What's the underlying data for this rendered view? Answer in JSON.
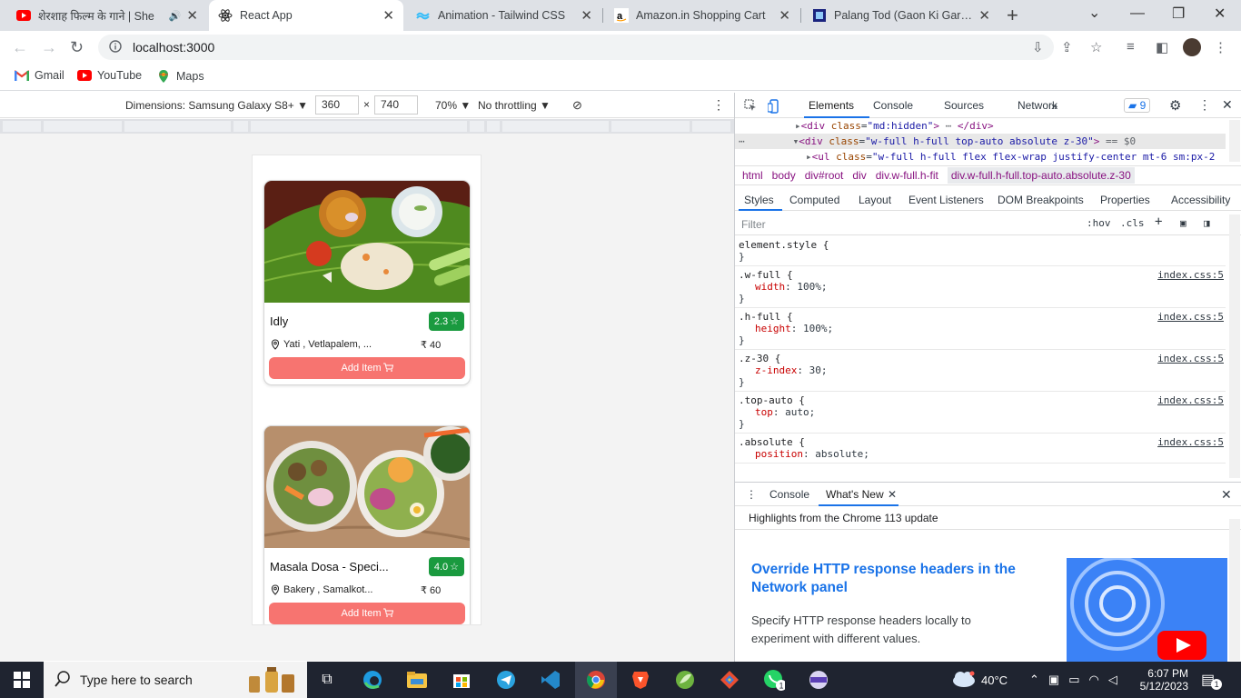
{
  "browser": {
    "tabs": [
      {
        "title": "शेरशाह फिल्म के गाने | She",
        "has_audio": true
      },
      {
        "title": "React App",
        "active": true
      },
      {
        "title": "Animation - Tailwind CSS"
      },
      {
        "title": "Amazon.in Shopping Cart"
      },
      {
        "title": "Palang Tod (Gaon Ki Garmi 3"
      }
    ],
    "url": "localhost:3000",
    "bookmarks": [
      "Gmail",
      "YouTube",
      "Maps"
    ]
  },
  "device_toolbar": {
    "dimensions_label": "Dimensions: Samsung Galaxy S8+",
    "width": "360",
    "times": "×",
    "height": "740",
    "zoom": "70%",
    "throttling": "No throttling"
  },
  "app": {
    "cards": [
      {
        "name": "Idly",
        "rating": "2.3",
        "location": "Yati , Vetlapalem, ...",
        "price": "₹ 40",
        "button": "Add Item"
      },
      {
        "name": "Masala Dosa - Speci...",
        "rating": "4.0",
        "location": "Bakery , Samalkot...",
        "price": "₹ 60",
        "button": "Add Item"
      }
    ]
  },
  "devtools": {
    "tabs": [
      "Elements",
      "Console",
      "Sources",
      "Network"
    ],
    "issues_count": "9",
    "dom_lines": [
      {
        "tag": "div",
        "attr_name": "class",
        "attr_value": "md:hidden",
        "suffix": "</div>"
      },
      {
        "tag": "div",
        "attr_name": "class",
        "attr_value": "w-full h-full top-auto absolute z-30",
        "suffix": "== $0"
      },
      {
        "tag": "ul",
        "attr_name": "class",
        "attr_value": "w-full h-full flex flex-wrap justify-center mt-6  sm:px-2",
        "suffix": ""
      }
    ],
    "breadcrumbs": [
      "html",
      "body",
      "div#root",
      "div",
      "div.w-full.h-fit",
      "div.w-full.h-full.top-auto.absolute.z-30"
    ],
    "sub_tabs": [
      "Styles",
      "Computed",
      "Layout",
      "Event Listeners",
      "DOM Breakpoints",
      "Properties",
      "Accessibility"
    ],
    "filter_placeholder": "Filter",
    "hov": ":hov",
    "cls": ".cls",
    "element_style": "element.style {",
    "rules": [
      {
        "selector": ".w-full {",
        "prop": "width",
        "value": "100%;",
        "source": "index.css:5"
      },
      {
        "selector": ".h-full {",
        "prop": "height",
        "value": "100%;",
        "source": "index.css:5"
      },
      {
        "selector": ".z-30 {",
        "prop": "z-index",
        "value": "30;",
        "source": "index.css:5"
      },
      {
        "selector": ".top-auto {",
        "prop": "top",
        "value": "auto;",
        "source": "index.css:5"
      },
      {
        "selector": ".absolute {",
        "prop": "position",
        "value": "absolute;",
        "source": "index.css:5"
      }
    ],
    "drawer": {
      "tabs": [
        "Console",
        "What's New"
      ],
      "highlights": "Highlights from the Chrome 113 update",
      "heading": "Override HTTP response headers in the Network panel",
      "body": "Specify HTTP response headers locally to experiment with different values."
    }
  },
  "taskbar": {
    "search_placeholder": "Type here to search",
    "weather": "40°C",
    "time": "6:07 PM",
    "date": "5/12/2023",
    "notifications": "1"
  }
}
